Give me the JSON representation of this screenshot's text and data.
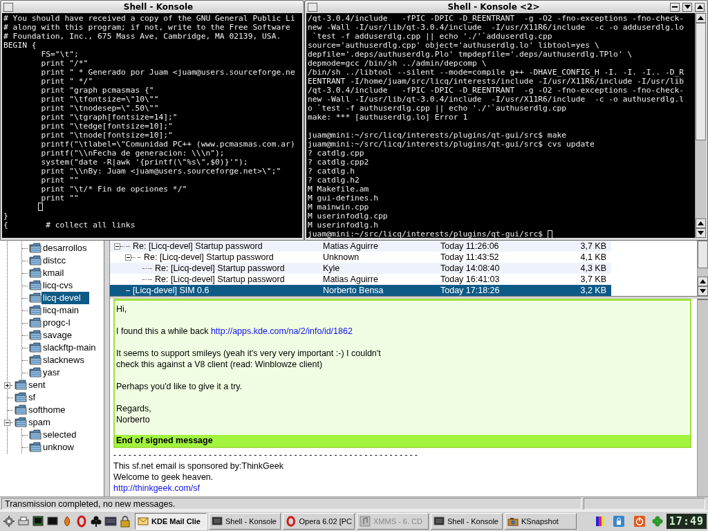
{
  "konsoles": [
    {
      "title": "Shell - Konsole",
      "segments": [
        {
          "kind": "text",
          "lines": [
            "# You should have received a copy of the GNU General Public Li",
            "# along with this program; if not, write to the Free Software",
            "# Foundation, Inc., 675 Mass Ave, Cambridge, MA 02139, USA.",
            "BEGIN {",
            "        FS=\"\\t\";",
            "        print \"/*\"",
            "        print \" * Generado por Juam <juam@users.sourceforge.ne",
            "        print \" */\"",
            "        print \"graph pcmasmas {\"",
            "        print \"\\tfontsize=\\\"10\\\"\"",
            "        print \"\\tnodesep=\\\".50\\\"\"",
            "        print \"\\tgraph[fontsize=14];\"",
            "        print \"\\tedge[fontsize=10];\"",
            "        print \"\\tnode[fontsize=10];\"",
            "        printf(\"\\tlabel=\\\"Comunidad PC++ (www.pcmasmas.com.ar)",
            "        printf(\"\\\\nFecha de generacion: \\\\\\n\");",
            "        system(\"date -R|awk '{printf(\\\"%s\\\",$0)}'\");",
            "        print \"\\\\nBy: Juam <juam@users.sourceforge.net>\\\";\"",
            "        print \"\"",
            "        print \"\\t/* Fin de opciones */\"",
            "        print \"\""
          ]
        },
        {
          "kind": "cursor"
        },
        {
          "kind": "text",
          "lines": [
            "}",
            "{        # collect all links"
          ]
        }
      ]
    },
    {
      "title": "Shell - Konsole <2>",
      "segments": [
        {
          "kind": "text",
          "lines": [
            "/qt-3.0.4/include   -fPIC -DPIC -D_REENTRANT  -g -O2 -fno-exceptions -fno-check-",
            "new -Wall -I/usr/lib/qt-3.0.4/include  -I/usr/X11R6/include  -c -o adduserdlg.lo",
            " `test -f adduserdlg.cpp || echo './'`adduserdlg.cpp",
            "source='authuserdlg.cpp' object='authuserdlg.lo' libtool=yes \\",
            "depfile='.deps/authuserdlg.Plo' tmpdepfile='.deps/authuserdlg.TPlo' \\",
            "depmode=gcc /bin/sh ../admin/depcomp \\",
            "/bin/sh ../libtool --silent --mode=compile g++ -DHAVE_CONFIG_H -I. -I. -I.. -D_R",
            "EENTRANT -I/home/juam/src/licq/interests/include -I/usr/X11R6/include -I/usr/lib",
            "/qt-3.0.4/include   -fPIC -DPIC -D_REENTRANT  -g -O2 -fno-exceptions -fno-check-",
            "new -Wall -I/usr/lib/qt-3.0.4/include  -I/usr/X11R6/include  -c -o authuserdlg.l",
            "o `test -f authuserdlg.cpp || echo './'`authuserdlg.cpp",
            "make: *** [authuserdlg.lo] Error 1"
          ]
        },
        {
          "kind": "blank"
        },
        {
          "kind": "text",
          "lines": [
            "juam@mini:~/src/licq/interests/plugins/qt-gui/src$ make",
            "juam@mini:~/src/licq/interests/plugins/qt-gui/src$ cvs update",
            "? catdlg.cpp",
            "? catdlg.cpp2",
            "? catdlg.h",
            "? catdlg.h2",
            "M Makefile.am",
            "M gui-defines.h",
            "M mainwin.cpp",
            "M userinfodlg.cpp",
            "M userinfodlg.h"
          ]
        },
        {
          "kind": "prompt",
          "text": "juam@mini:~/src/licq/interests/plugins/qt-gui/src$"
        }
      ]
    }
  ],
  "folders": {
    "inner": [
      {
        "name": "desarrollos",
        "selected": false
      },
      {
        "name": "distcc",
        "selected": false
      },
      {
        "name": "kmail",
        "selected": false
      },
      {
        "name": "licq-cvs",
        "selected": false
      },
      {
        "name": "licq-devel",
        "selected": true
      },
      {
        "name": "licq-main",
        "selected": false
      },
      {
        "name": "progc-l",
        "selected": false
      },
      {
        "name": "savage",
        "selected": false
      },
      {
        "name": "slackftp-main",
        "selected": false
      },
      {
        "name": "slacknews",
        "selected": false
      },
      {
        "name": "yasr",
        "selected": false
      }
    ],
    "top": [
      {
        "name": "sent",
        "selected": false,
        "expanded": false
      },
      {
        "name": "sf",
        "selected": false
      },
      {
        "name": "softhome",
        "selected": false
      },
      {
        "name": "spam",
        "selected": false,
        "expanded": true,
        "children": [
          {
            "name": "selected",
            "selected": false
          },
          {
            "name": "unknow",
            "selected": false
          }
        ]
      }
    ]
  },
  "messages": [
    {
      "subject": "Re: [Licq-devel] Startup password",
      "sender": "Matias Aguirre",
      "date": "Today 11:26:06",
      "size": "3,7 KB",
      "selected": false,
      "expanded": true,
      "children": [
        {
          "subject": "Re: [Licq-devel] Startup password",
          "sender": "Unknown",
          "date": "Today 11:43:52",
          "size": "4,1 KB",
          "selected": false,
          "expanded": true,
          "children": [
            {
              "subject": "Re: [Licq-devel] Startup password",
              "sender": "Kyle",
              "date": "Today 14:08:40",
              "size": "4,3 KB",
              "selected": false
            },
            {
              "subject": "Re: [Licq-devel] Startup password",
              "sender": "Matias Aguirre",
              "date": "Today 16:41:03",
              "size": "3,7 KB",
              "selected": false
            }
          ]
        }
      ]
    },
    {
      "subject": "[Licq-devel] SIM 0.6",
      "sender": "Norberto Bensa",
      "date": "Today 17:18:26",
      "size": "3,2 KB",
      "selected": true
    }
  ],
  "message_body": {
    "paragraphs": [
      {
        "lines": [
          "Hi,"
        ]
      },
      {
        "lines": [
          "I found this a while back "
        ],
        "link": "http://apps.kde.com/na/2/info/id/1862"
      },
      {
        "lines": [
          "It seems to support smileys (yeah it's very very important :-) I couldn't",
          "check this against a V8 client (read: Winblowze client)"
        ]
      },
      {
        "lines": [
          "Perhaps you'd like to give it a try."
        ]
      },
      {
        "lines": [
          "Regards,",
          "Norberto"
        ]
      }
    ],
    "signature_footer": "End of signed message",
    "separator": "-------------------------------------------------------------",
    "footer_lines": [
      "This sf.net email is sponsored by:ThinkGeek",
      "Welcome to geek heaven."
    ],
    "footer_link": "http://thinkgeek.com/sf"
  },
  "status_bar": {
    "message": "Transmission completed, no new messages."
  },
  "taskbar": {
    "tasks": [
      {
        "label": "KDE Mail Clie",
        "kind": "mail",
        "selected": true,
        "minimized": false
      },
      {
        "label": "Shell - Konsole",
        "kind": "terminal",
        "selected": false,
        "minimized": false
      },
      {
        "label": "Opera 6.02   [PC",
        "kind": "opera",
        "selected": false,
        "minimized": false
      },
      {
        "label": "XMMS - 6. CD",
        "kind": "xmms",
        "selected": false,
        "minimized": true
      },
      {
        "label": "Shell - Konsole",
        "kind": "terminal",
        "selected": false,
        "minimized": false
      },
      {
        "label": "KSnapshot",
        "kind": "snapshot",
        "selected": false,
        "minimized": false
      }
    ],
    "clock": "17:49"
  }
}
